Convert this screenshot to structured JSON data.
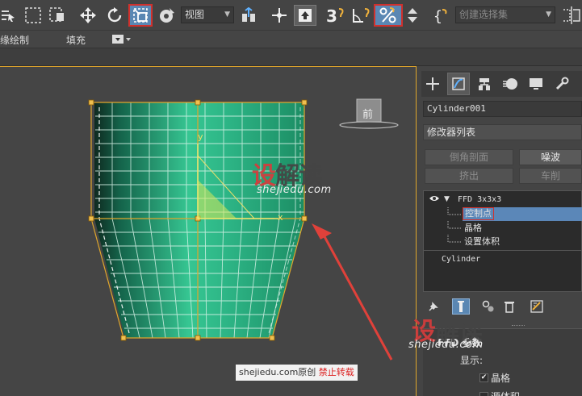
{
  "toolbar": {
    "view_combo": "视图",
    "selection_set_placeholder": "创建选择集"
  },
  "subbar": {
    "left_text": "缘绘制",
    "fill_label": "填充"
  },
  "viewport": {
    "viewcube_label": "前",
    "gizmo_y_label": "y",
    "gizmo_x_label": "x",
    "watermark_logo_first": "设",
    "watermark_logo_rest": "解读",
    "watermark_url": "shejiedu.com",
    "caption_site": "shejiedu.com",
    "caption_original": "原创",
    "caption_forbid": "禁止转载"
  },
  "panel": {
    "object_name": "Cylinder001",
    "modifier_list": "修改器列表",
    "buttons": [
      "倒角剖面",
      "噪波",
      "挤出",
      "车削"
    ],
    "stack": {
      "ffd": "FFD 3x3x3",
      "control_points": "控制点",
      "lattice": "晶格",
      "set_volume": "设置体积",
      "base": "Cylinder"
    },
    "rollout": {
      "title": "FFD 参数",
      "display": "显示:",
      "lattice_check": "晶格",
      "source_volume": "源体积",
      "watermark_logo_first": "设",
      "watermark_logo_rest": "解读",
      "watermark_url": "shejiedu.com"
    }
  },
  "colors": {
    "accent_blue": "#5a87b3",
    "highlight_red": "#d0312d",
    "lattice_orange": "#e0a62c",
    "object_green": "#2fb886"
  }
}
